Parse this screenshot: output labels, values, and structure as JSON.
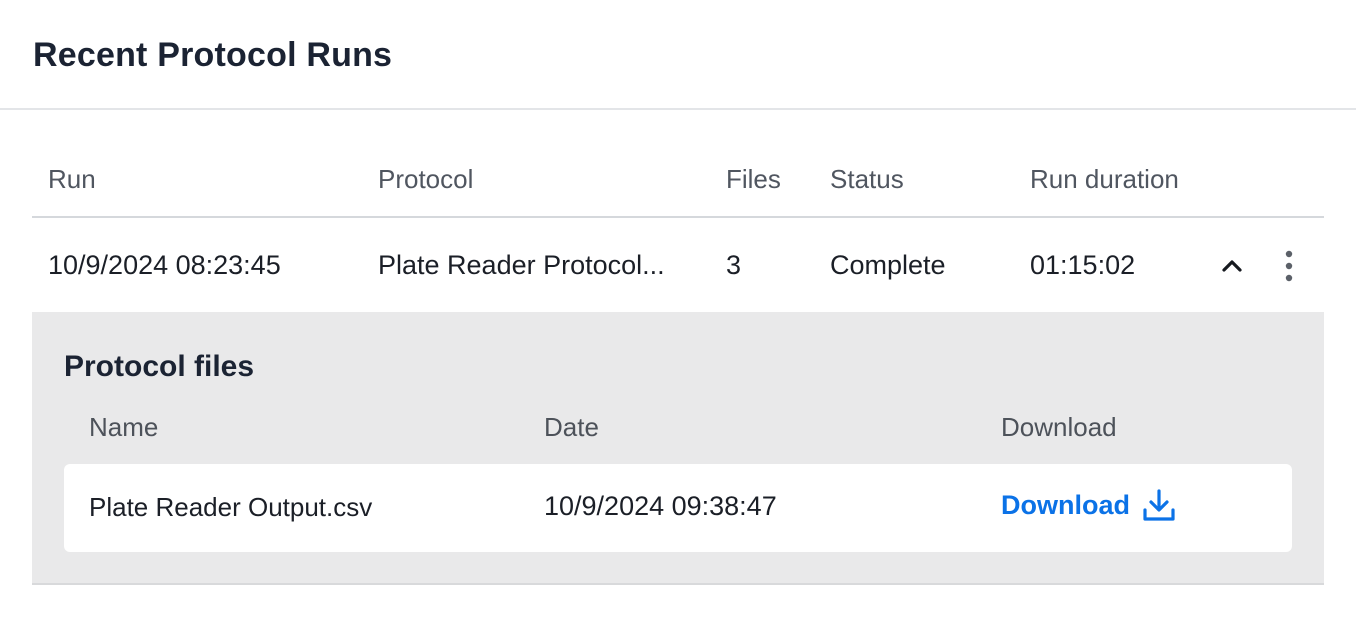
{
  "title": "Recent Protocol Runs",
  "table": {
    "columns": [
      "Run",
      "Protocol",
      "Files",
      "Status",
      "Run duration"
    ],
    "rows": [
      {
        "run": "10/9/2024 08:23:45",
        "protocol": "Plate Reader Protocol...",
        "files": "3",
        "status": "Complete",
        "duration": "01:15:02",
        "expanded": true
      }
    ]
  },
  "protocol_files": {
    "heading": "Protocol files",
    "columns": [
      "Name",
      "Date",
      "Download"
    ],
    "files": [
      {
        "name": "Plate Reader Output.csv",
        "date": "10/9/2024 09:38:47",
        "download_label": "Download"
      }
    ]
  },
  "icons": {
    "collapse": "chevron-up-icon",
    "menu": "more-vertical-icon",
    "download": "download-icon"
  },
  "colors": {
    "link": "#0b72e7",
    "expanded_bg": "#e9e9ea",
    "title": "#1b2333"
  }
}
